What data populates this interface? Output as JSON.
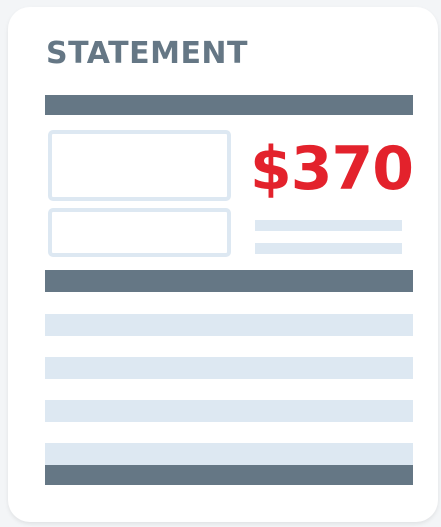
{
  "statement": {
    "title": "STATEMENT",
    "amount": "$370"
  },
  "colors": {
    "dark_bar": "#657785",
    "light_bar": "#dde8f2",
    "amount": "#e3222c",
    "title": "#657785",
    "card": "#ffffff",
    "background": "#f3f5f7"
  }
}
